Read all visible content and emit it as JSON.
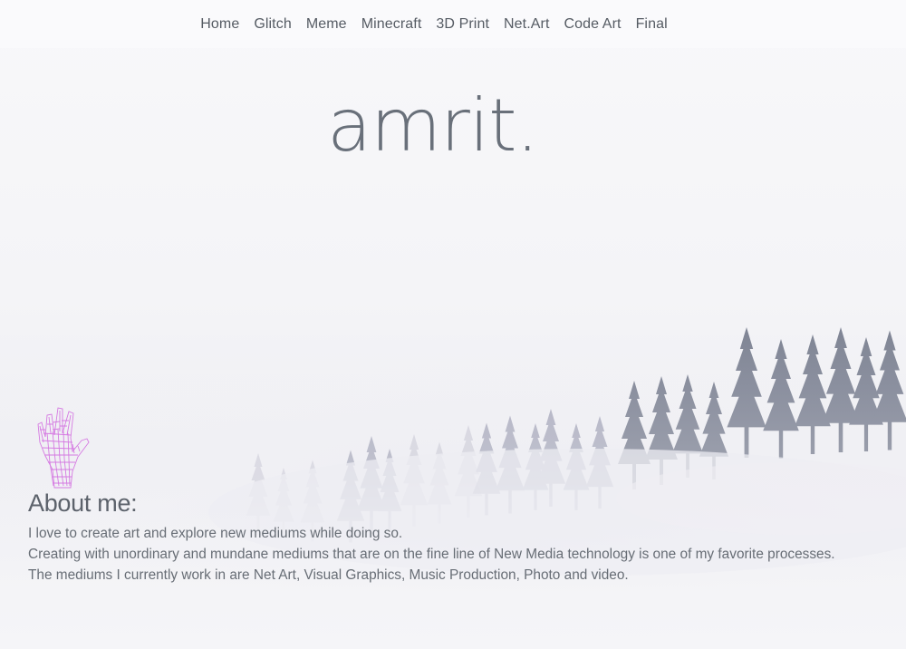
{
  "nav": {
    "items": [
      {
        "label": "Home"
      },
      {
        "label": "Glitch"
      },
      {
        "label": "Meme"
      },
      {
        "label": "Minecraft"
      },
      {
        "label": "3D Print"
      },
      {
        "label": "Net.Art"
      },
      {
        "label": "Code Art"
      },
      {
        "label": "Final"
      }
    ]
  },
  "hero": {
    "title": "amrit."
  },
  "about": {
    "heading": "About me:",
    "lines": [
      "I love to create art and explore new mediums while doing so.",
      "Creating with unordinary and mundane mediums that are on the fine line of New Media technology is one of my favorite processes.",
      "The mediums I currently work in are Net Art, Visual Graphics, Music Production, Photo and video."
    ]
  },
  "colors": {
    "nav_text": "#555b63",
    "title": "#69707a",
    "trees": "#5d6478",
    "hand": "#d36ee0"
  },
  "icons": {
    "hand": "wireframe-hand-icon"
  }
}
